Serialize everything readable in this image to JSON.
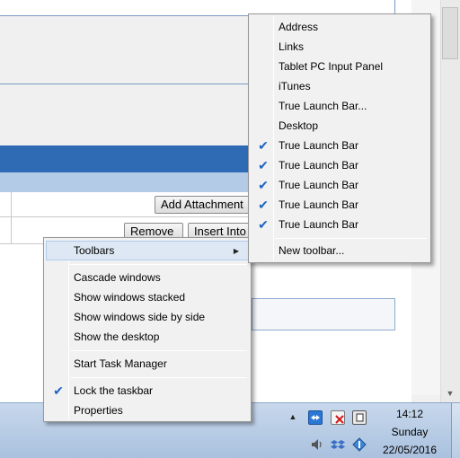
{
  "background_window": {
    "buttons": {
      "add_attachment": "Add Attachment",
      "remove": "Remove",
      "insert_into": "Insert Into"
    }
  },
  "taskbar_menu": {
    "toolbars": "Toolbars",
    "cascade": "Cascade windows",
    "stacked": "Show windows stacked",
    "side_by_side": "Show windows side by side",
    "show_desktop": "Show the desktop",
    "task_manager": "Start Task Manager",
    "lock_taskbar": "Lock the taskbar",
    "lock_taskbar_checked": true,
    "properties": "Properties"
  },
  "toolbars_submenu": {
    "items": [
      {
        "label": "Address",
        "checked": false
      },
      {
        "label": "Links",
        "checked": false
      },
      {
        "label": "Tablet PC Input Panel",
        "checked": false
      },
      {
        "label": "iTunes",
        "checked": false
      },
      {
        "label": "True Launch Bar...",
        "checked": false
      },
      {
        "label": "Desktop",
        "checked": false
      },
      {
        "label": "True Launch Bar",
        "checked": true
      },
      {
        "label": "True Launch Bar",
        "checked": true
      },
      {
        "label": "True Launch Bar",
        "checked": true
      },
      {
        "label": "True Launch Bar",
        "checked": true
      },
      {
        "label": "True Launch Bar",
        "checked": true
      }
    ],
    "new_toolbar": "New toolbar..."
  },
  "tray": {
    "icons": [
      "show-hidden-icons-chevron",
      "teamviewer-icon",
      "network-blocked-icon",
      "notes-icon",
      "speaker-icon",
      "dropbox-icon",
      "update-icon"
    ]
  },
  "clock": {
    "time": "14:12",
    "day": "Sunday",
    "date": "22/05/2016"
  },
  "colors": {
    "accent_blue": "#2f6ab5",
    "check_blue": "#1c63c5",
    "menu_bg": "#f1f1f1",
    "highlight": "#dde8f4"
  }
}
